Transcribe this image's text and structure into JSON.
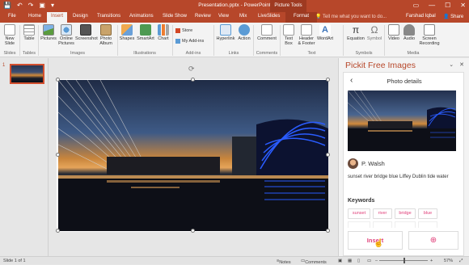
{
  "titlebar": {
    "quick_access": [
      "💾",
      "↶",
      "↷",
      "▣",
      "▾"
    ],
    "title": "Presentation.pptx - PowerPoint",
    "context_label": "Picture Tools",
    "window_buttons": [
      "▭",
      "—",
      "☐",
      "✕"
    ]
  },
  "tabs": {
    "items": [
      "File",
      "Home",
      "Insert",
      "Design",
      "Transitions",
      "Animations",
      "Slide Show",
      "Review",
      "View",
      "Mix",
      "LiveSlides",
      "Format"
    ],
    "active": "Insert",
    "tell_me": "Tell me what you want to do...",
    "user": "Farshad Iqbal",
    "share": "Share"
  },
  "ribbon": {
    "buttons": {
      "new_slide": "New Slide",
      "table": "Table",
      "pictures": "Pictures",
      "online_pictures": "Online Pictures",
      "screenshot": "Screenshot",
      "photo_album": "Photo Album",
      "shapes": "Shapes",
      "smartart": "SmartArt",
      "chart": "Chart",
      "store": "Store",
      "my_addins": "My Add-ins",
      "hyperlink": "Hyperlink",
      "action": "Action",
      "comment": "Comment",
      "text_box": "Text Box",
      "header_footer": "Header & Footer",
      "wordart": "WordArt",
      "equation": "Equation",
      "symbol": "Symbol",
      "video": "Video",
      "audio": "Audio",
      "screen_recording": "Screen Recording"
    },
    "groups": {
      "slides": "Slides",
      "tables": "Tables",
      "images": "Images",
      "illustrations": "Illustrations",
      "addins": "Add-ins",
      "links": "Links",
      "comments": "Comments",
      "text": "Text",
      "symbols": "Symbols",
      "media": "Media"
    }
  },
  "thumbnails": {
    "slide_number": "1"
  },
  "pane": {
    "title": "Pickit Free Images",
    "controls": [
      "⌄",
      "✕"
    ],
    "back": "‹",
    "card_title": "Photo details",
    "author": "P. Walsh",
    "description": "sunset river bridge blue Liffey Dublin tide water",
    "keywords_title": "Keywords",
    "keywords": [
      "sunset",
      "river",
      "bridge",
      "blue"
    ],
    "insert_label": "Insert",
    "add_icon": "⊕"
  },
  "status": {
    "slide": "Slide 1 of 1",
    "notes": "Notes",
    "comments": "Comments",
    "zoom_minus": "–",
    "zoom_plus": "+",
    "zoom": "57%"
  },
  "colors": {
    "accent": "#b7472a",
    "pickit_pink": "#e0407a"
  }
}
